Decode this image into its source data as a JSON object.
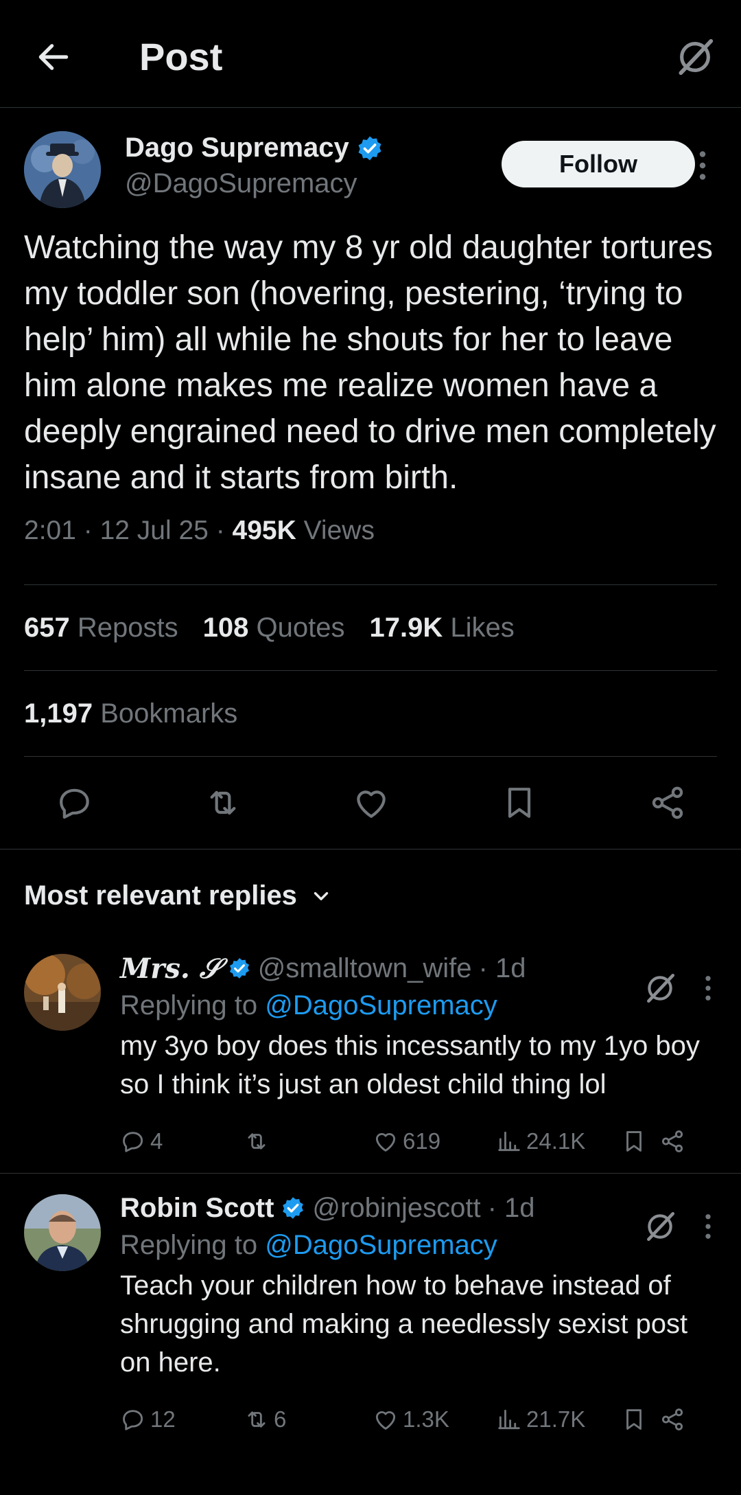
{
  "header": {
    "title": "Post"
  },
  "post": {
    "author_name": "Dago Supremacy",
    "author_handle": "@DagoSupremacy",
    "follow_label": "Follow",
    "text": "Watching the way my 8 yr old daughter tortures my toddler son (hovering, pestering, ‘trying to help’ him) all while he shouts for her to leave him alone makes me realize women have a deeply engrained need to drive men completely insane and it starts from birth.",
    "time": "2:01",
    "date": "12 Jul 25",
    "views_count": "495K",
    "views_label": "Views",
    "reposts_count": "657",
    "reposts_label": "Reposts",
    "quotes_count": "108",
    "quotes_label": "Quotes",
    "likes_count": "17.9K",
    "likes_label": "Likes",
    "bookmarks_count": "1,197",
    "bookmarks_label": "Bookmarks"
  },
  "replies_header": "Most relevant replies",
  "replies": [
    {
      "name": "Mrs. 𝒮",
      "handle": "@smalltown_wife",
      "age": "· 1d",
      "replying_prefix": "Replying to",
      "replying_handle": "@DagoSupremacy",
      "text": "my 3yo boy does this incessantly to my 1yo boy so I think it’s just an oldest child thing lol",
      "replies": "4",
      "reposts": "",
      "likes": "619",
      "views": "24.1K"
    },
    {
      "name": "Robin Scott",
      "handle": "@robinjescott",
      "age": "· 1d",
      "replying_prefix": "Replying to",
      "replying_handle": "@DagoSupremacy",
      "text": "Teach your children how to behave instead of shrugging and making a needlessly sexist post on here.",
      "replies": "12",
      "reposts": "6",
      "likes": "1.3K",
      "views": "21.7K"
    }
  ],
  "colors": {
    "background": "#000000",
    "text": "#e7e9ea",
    "secondary": "#71767b",
    "accent": "#1d9bf0",
    "divider": "#2f3336"
  },
  "icons": [
    "back-arrow-icon",
    "grok-icon",
    "verified-badge-icon",
    "more-icon",
    "reply-icon",
    "repost-icon",
    "like-icon",
    "bookmark-icon",
    "share-icon",
    "views-icon",
    "chevron-down-icon"
  ]
}
